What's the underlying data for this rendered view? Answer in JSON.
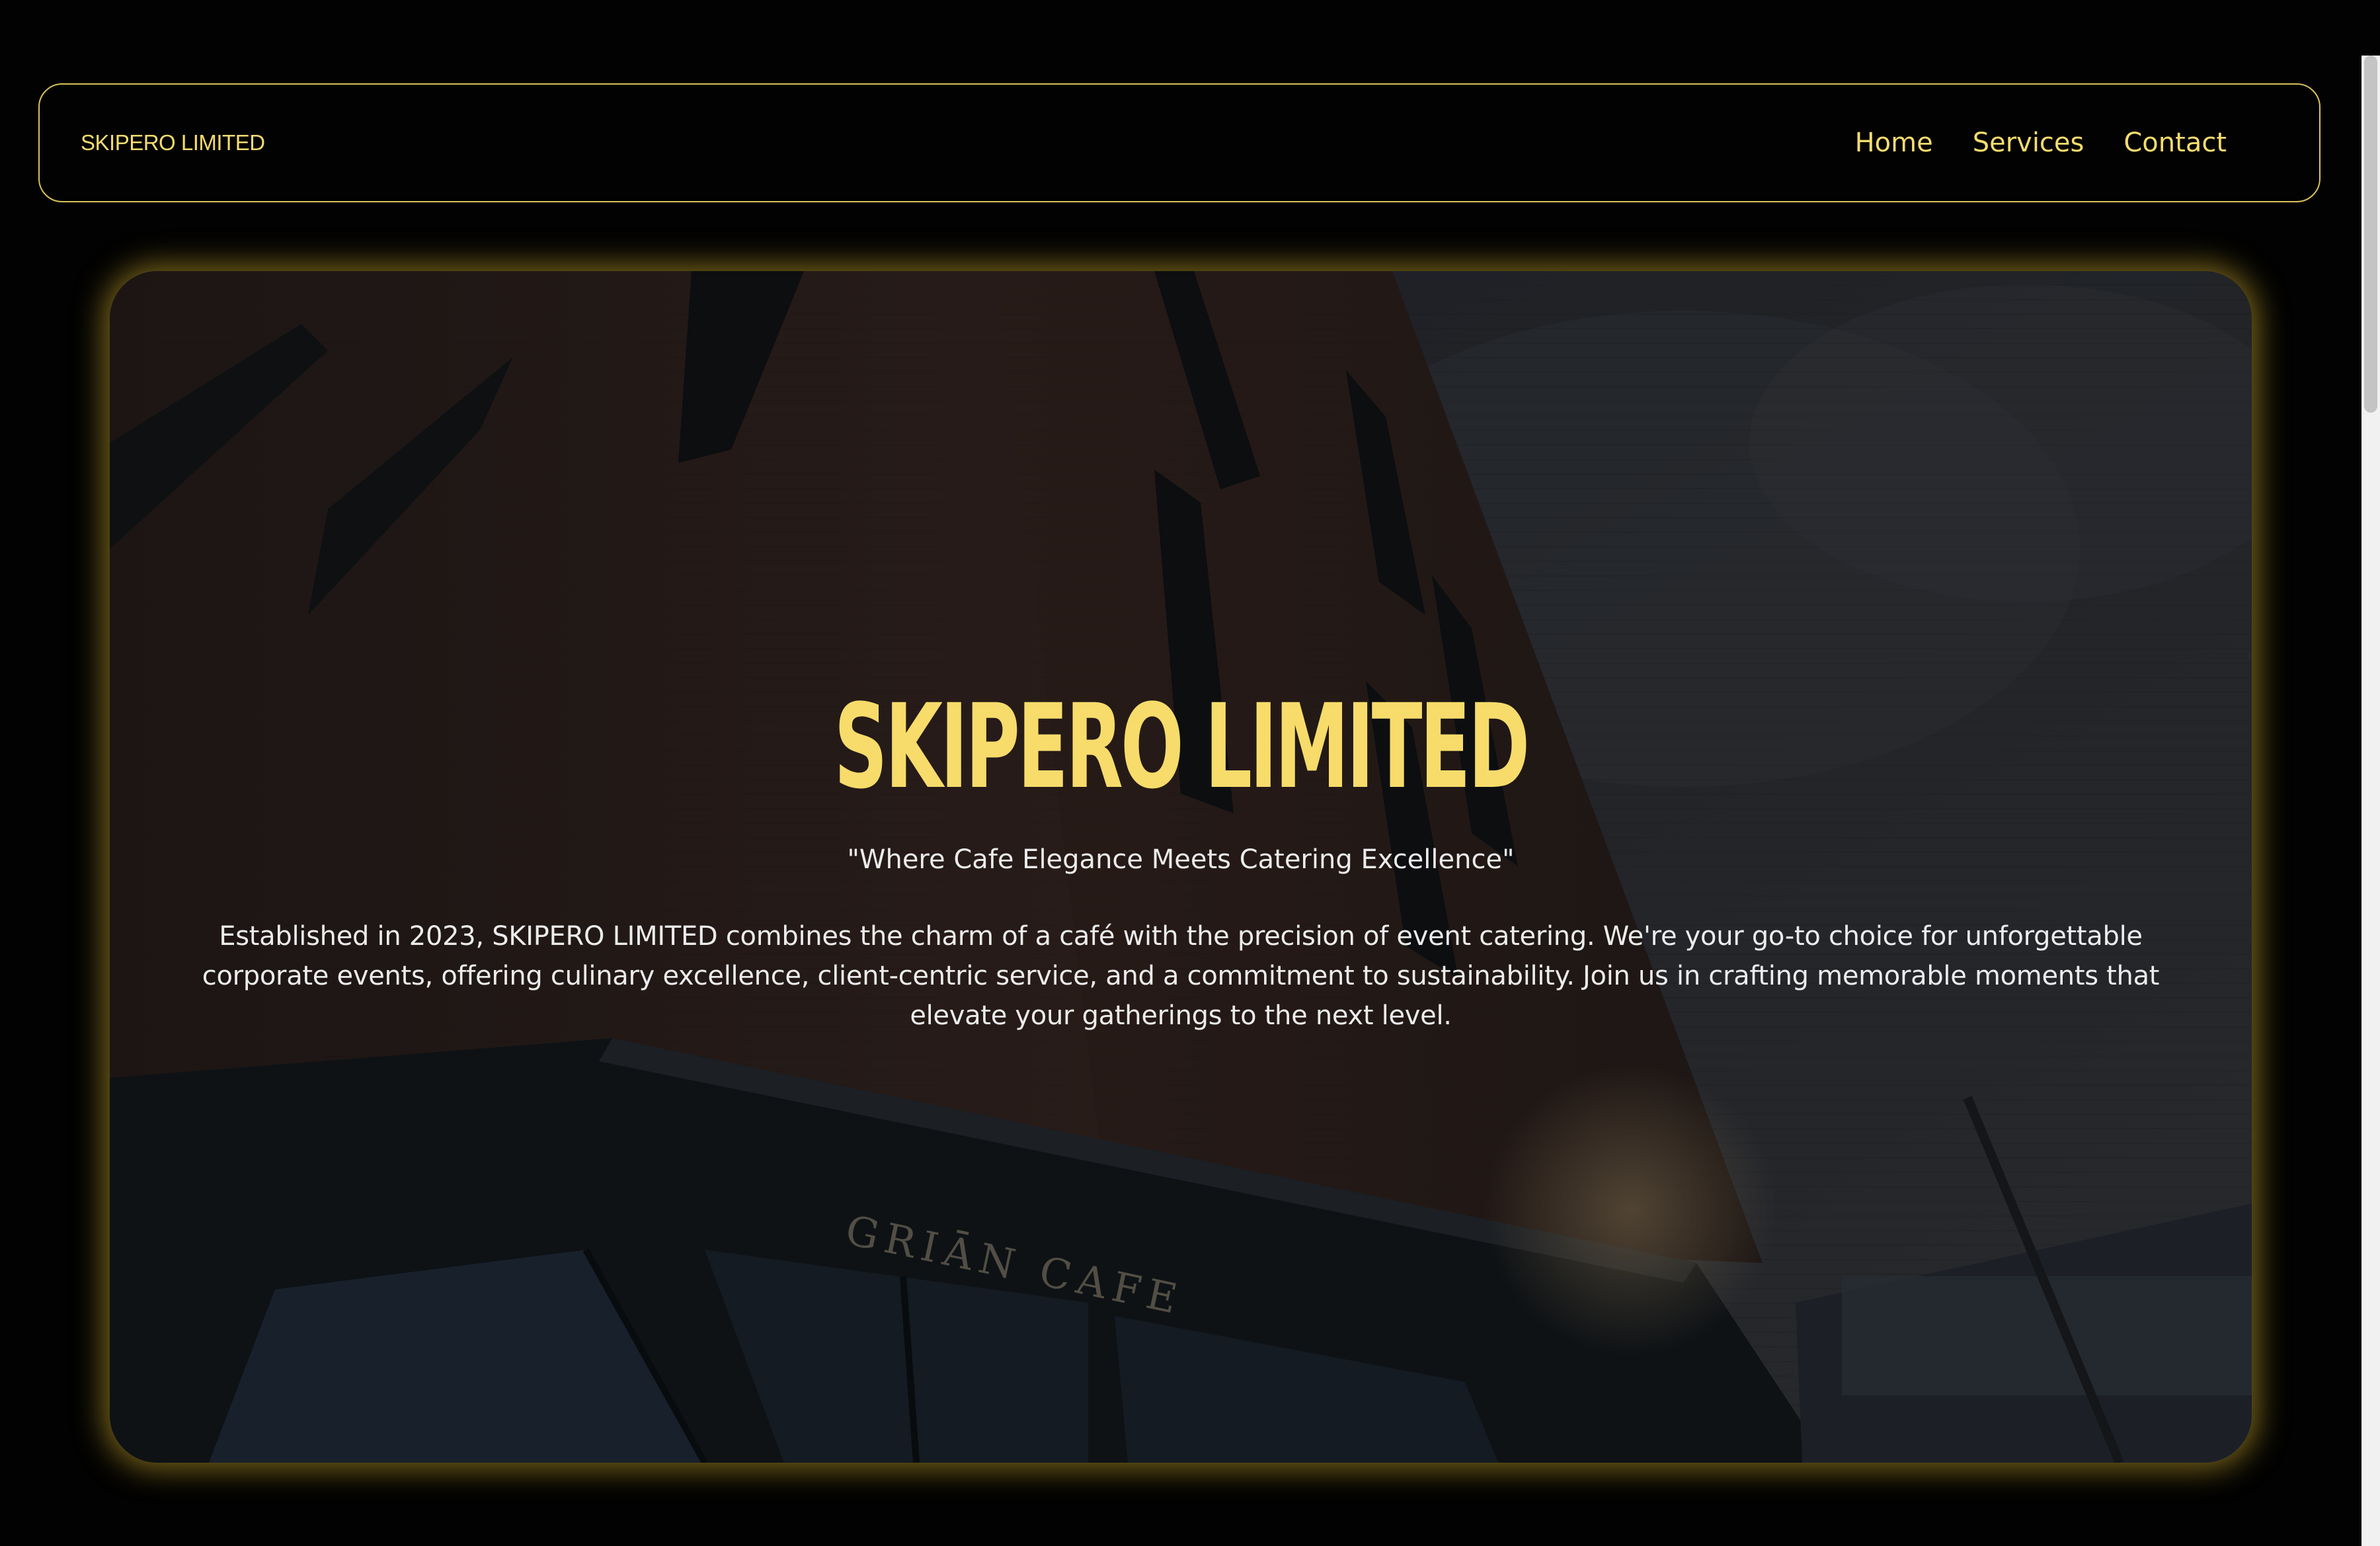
{
  "navbar": {
    "brand": "SKIPERO LIMITED",
    "links": [
      {
        "label": "Home"
      },
      {
        "label": "Services"
      },
      {
        "label": "Contact"
      }
    ]
  },
  "hero": {
    "title": "SKIPERO LIMITED",
    "tagline": "\"Where Cafe Elegance Meets Catering Excellence\"",
    "description": "Established in 2023, SKIPERO LIMITED combines the charm of a café with the precision of event catering. We're your go-to choice for unforgettable corporate events, offering culinary excellence, client-centric service, and a commitment to sustainability. Join us in crafting memorable moments that elevate your gatherings to the next level.",
    "background_signage": "GRIĀN CAFE"
  },
  "colors": {
    "accent": "#f6dc6e",
    "glow": "#d6b02d",
    "background": "#020202",
    "text_light": "#ececec"
  }
}
